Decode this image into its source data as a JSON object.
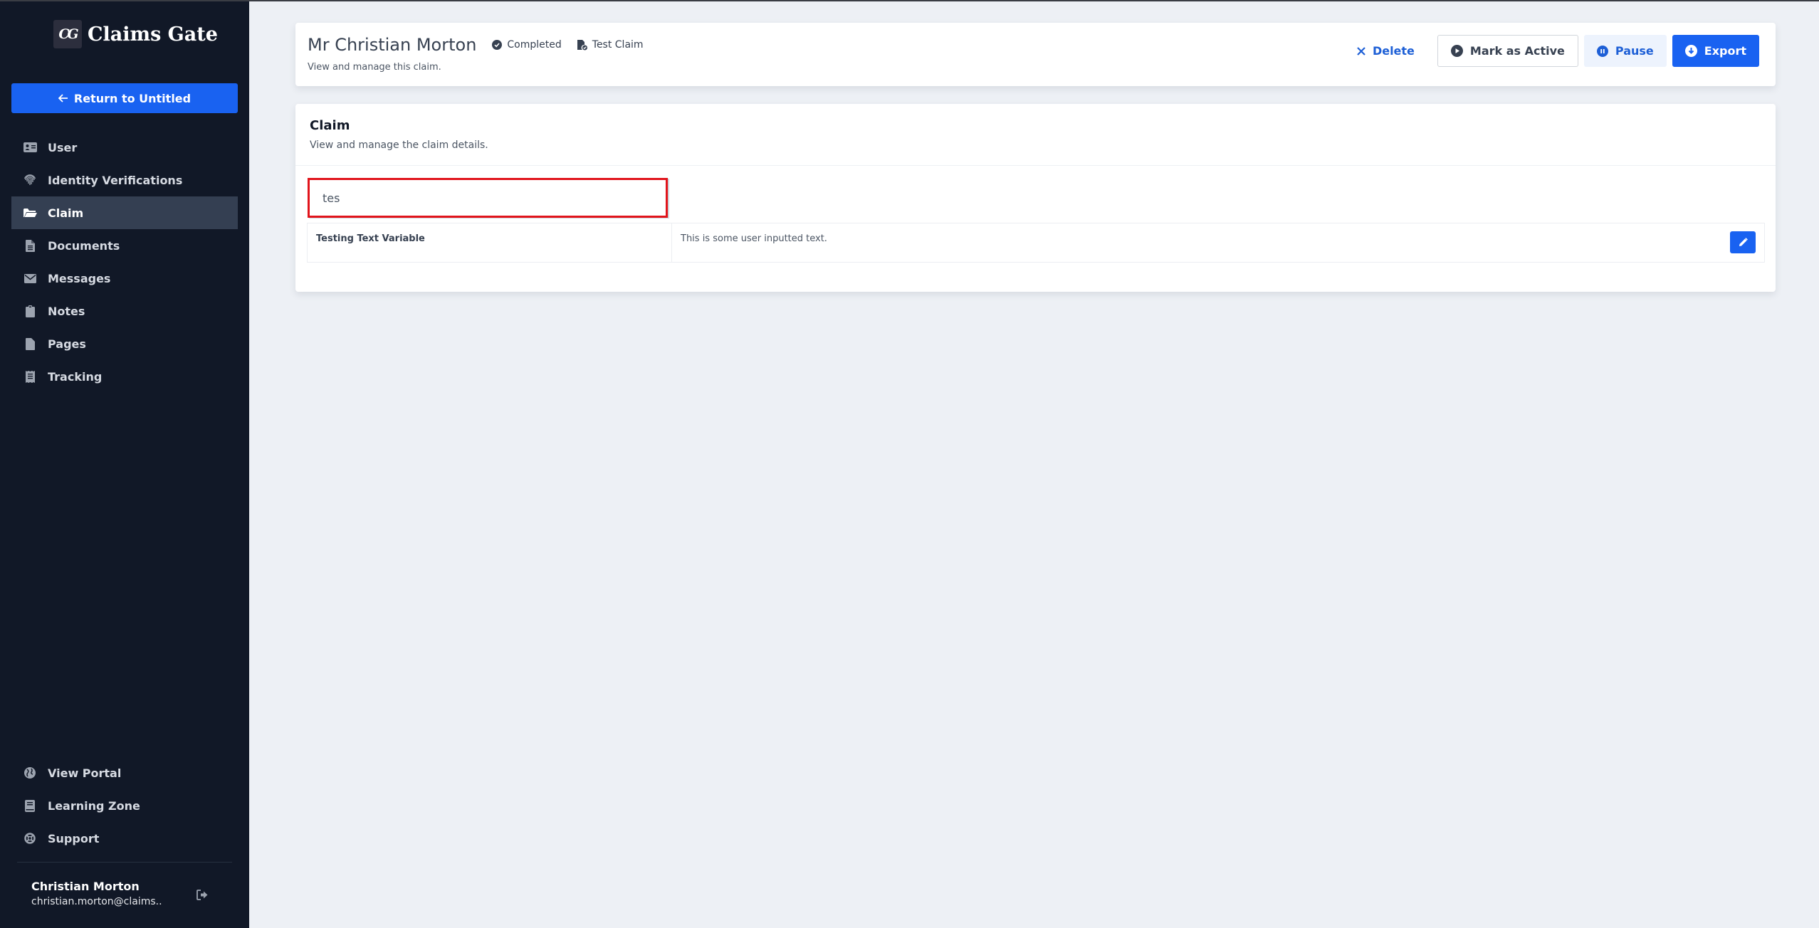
{
  "sidebar": {
    "logo": {
      "mark": "CG",
      "text": "Claims Gate"
    },
    "return_button": "Return to Untitled",
    "nav_items": [
      {
        "label": "User",
        "icon": "id-card-icon",
        "active": false
      },
      {
        "label": "Identity Verifications",
        "icon": "fingerprint-icon",
        "active": false
      },
      {
        "label": "Claim",
        "icon": "folder-open-icon",
        "active": true
      },
      {
        "label": "Documents",
        "icon": "file-text-icon",
        "active": false
      },
      {
        "label": "Messages",
        "icon": "envelope-icon",
        "active": false
      },
      {
        "label": "Notes",
        "icon": "clipboard-icon",
        "active": false
      },
      {
        "label": "Pages",
        "icon": "file-icon",
        "active": false
      },
      {
        "label": "Tracking",
        "icon": "receipt-icon",
        "active": false
      }
    ],
    "bottom_items": [
      {
        "label": "View Portal",
        "icon": "globe-icon"
      },
      {
        "label": "Learning Zone",
        "icon": "book-icon"
      },
      {
        "label": "Support",
        "icon": "life-ring-icon"
      }
    ],
    "user": {
      "name": "Christian Morton",
      "email": "christian.morton@claims.."
    }
  },
  "header": {
    "title": "Mr Christian Morton",
    "status": "Completed",
    "claim_type": "Test Claim",
    "subtitle": "View and manage this claim.",
    "actions": {
      "delete": "Delete",
      "mark_active": "Mark as Active",
      "pause": "Pause",
      "export": "Export"
    }
  },
  "claim": {
    "title": "Claim",
    "subtitle": "View and manage the claim details.",
    "search_value": "tes",
    "rows": [
      {
        "label": "Testing Text Variable",
        "value": "This is some user inputted text."
      }
    ]
  },
  "colors": {
    "sidebar_bg": "#111827",
    "accent": "#1962f1",
    "active_nav_bg": "#343f52",
    "highlight_border": "#e1141b"
  }
}
